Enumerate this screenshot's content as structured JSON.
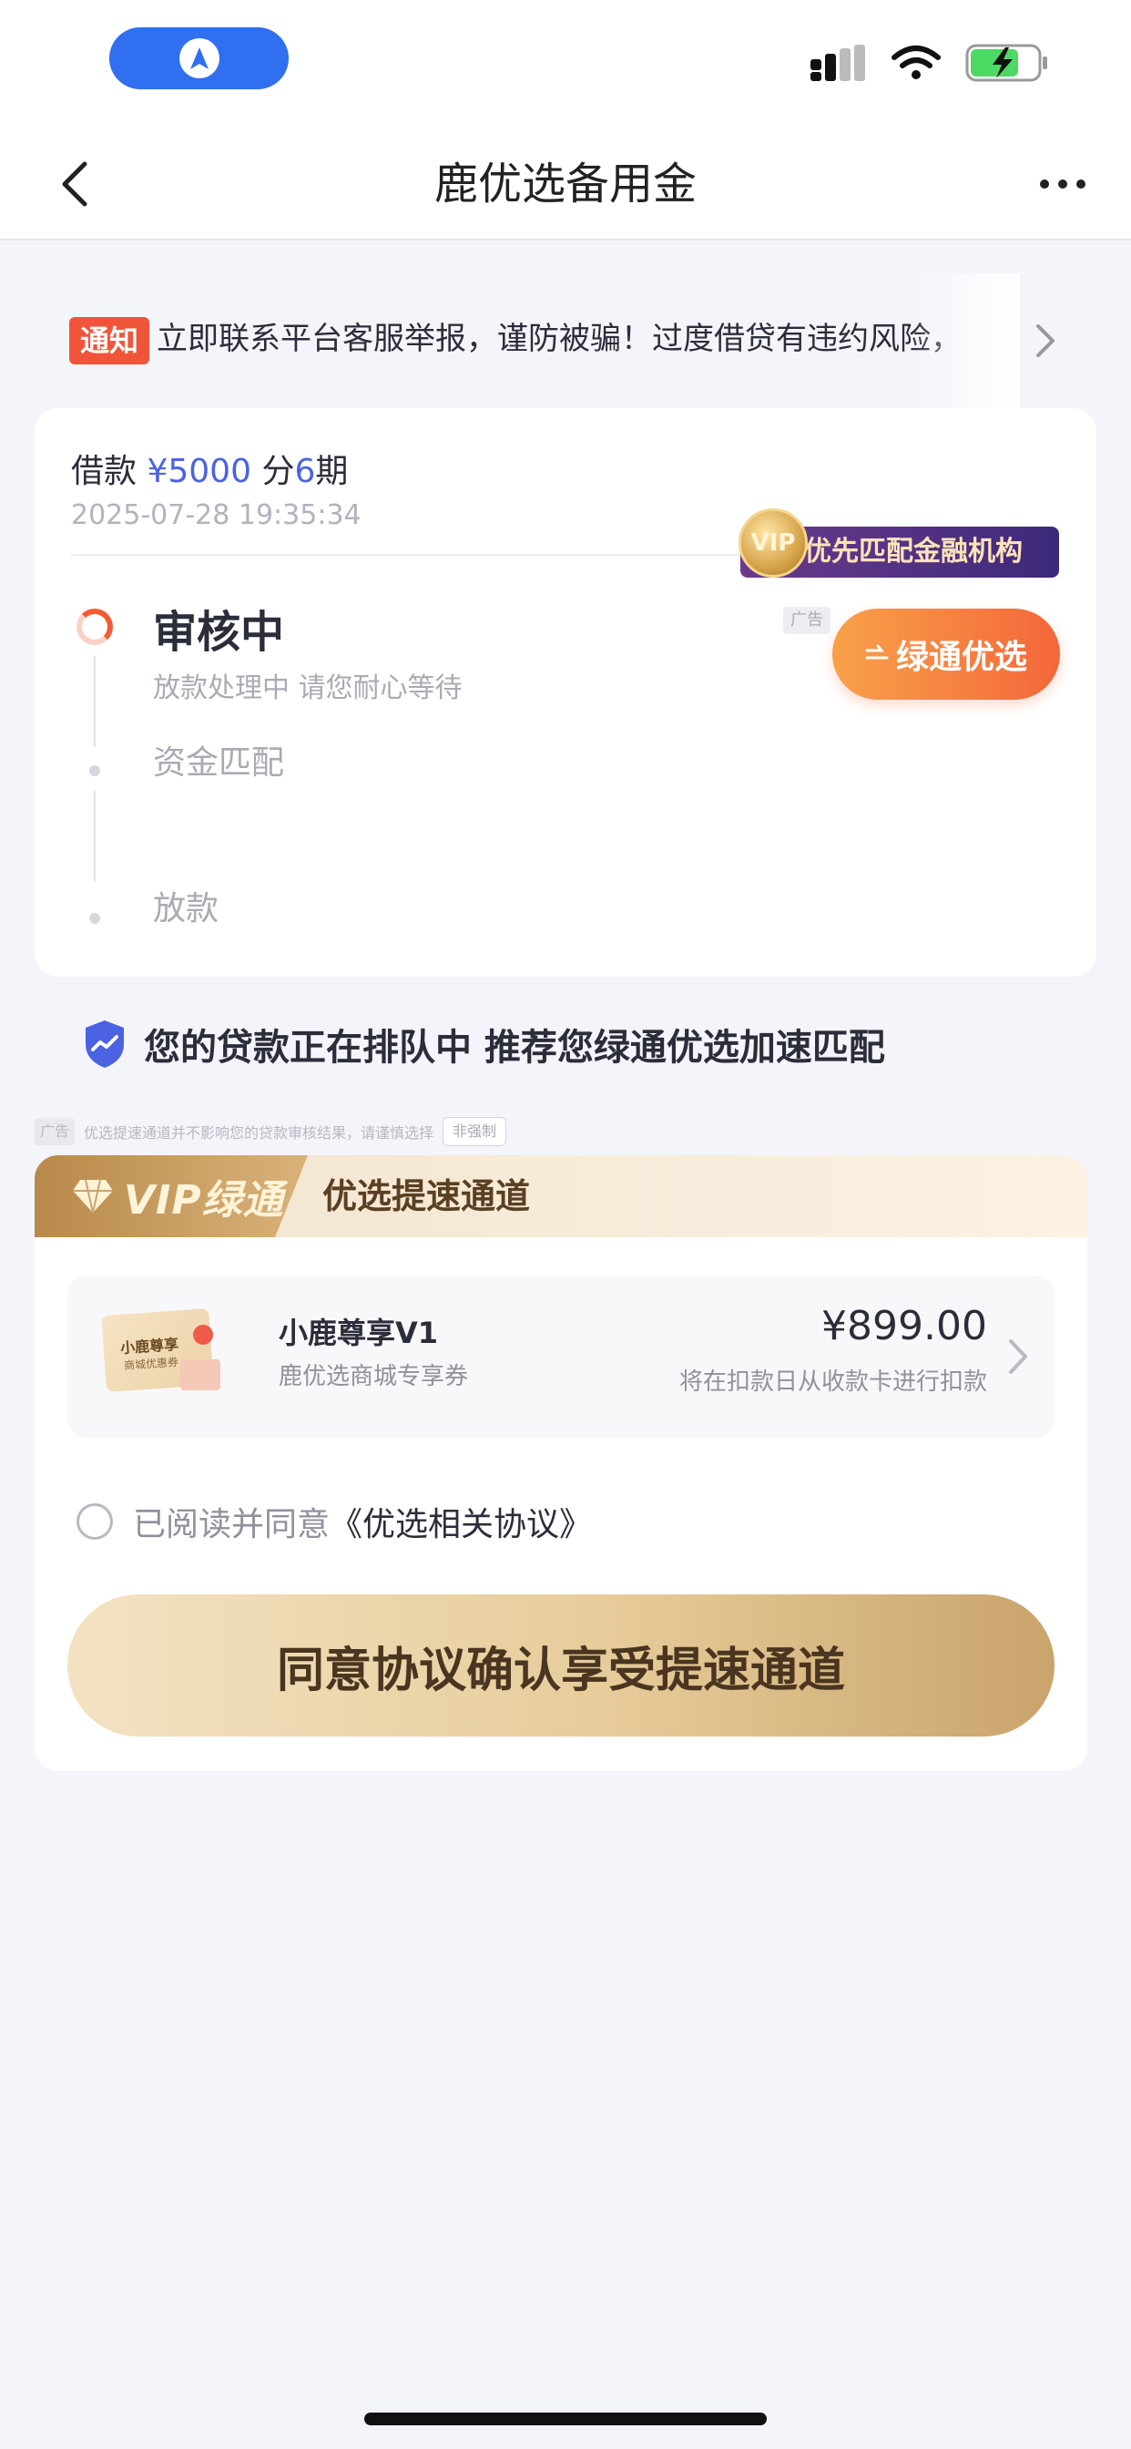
{
  "header": {
    "title": "鹿优选备用金"
  },
  "notice": {
    "tag": "通知",
    "text": "立即联系平台客服举报，谨防被骗！过度借贷有违约风险，"
  },
  "loan": {
    "prefix": "借款",
    "amount": "¥5000",
    "period_prefix": "分",
    "period_count": "6",
    "period_suffix": "期",
    "datetime": "2025-07-28 19:35:34",
    "badge_text": "优先匹配金融机构",
    "badge_coin": "VIP",
    "ad_label": "广告",
    "green_button": "绿通优选",
    "steps": [
      {
        "title": "审核中",
        "subtitle": "放款处理中 请您耐心等待"
      },
      {
        "title": "资金匹配"
      },
      {
        "title": "放款"
      }
    ]
  },
  "queue_message": "您的贷款正在排队中 推荐您绿通优选加速匹配",
  "disclaimer": {
    "ad": "广告",
    "text": "优选提速通道并不影响您的贷款审核结果，请谨慎选择",
    "tag": "非强制"
  },
  "vip": {
    "label": "VIP绿通",
    "channel": "优选提速通道",
    "product": {
      "coupon_title": "小鹿尊享",
      "coupon_sub": "商城优惠券",
      "name": "小鹿尊享V1",
      "desc": "鹿优选商城专享券",
      "price": "¥899.00",
      "note": "将在扣款日从收款卡进行扣款"
    },
    "agree_text": "已阅读并同意",
    "agree_link": "《优选相关协议》",
    "confirm": "同意协议确认享受提速通道"
  },
  "colors": {
    "accent_blue": "#4b62e3",
    "notice_red": "#f0553a",
    "green_btn": "#f3673a",
    "gold": "#c9a46b"
  }
}
